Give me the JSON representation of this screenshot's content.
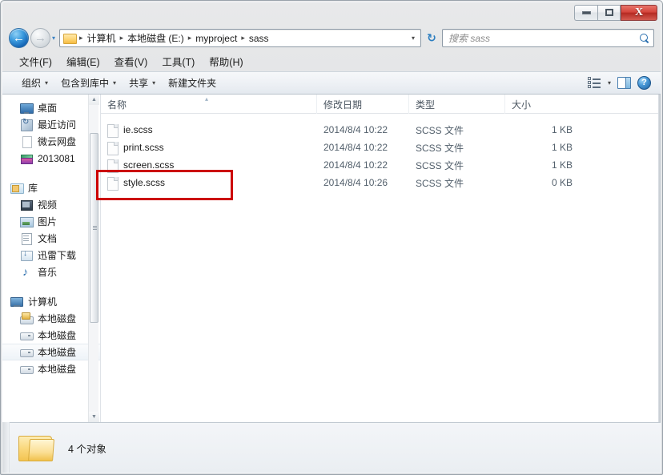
{
  "window": {
    "controls": {
      "minimize": "–",
      "maximize": "▭",
      "close": "X"
    }
  },
  "addressbar": {
    "back_glyph": "←",
    "forward_glyph": "→",
    "history_glyph": "▾",
    "dropdown_glyph": "▾",
    "refresh_glyph": "↻",
    "crumbs": [
      {
        "label": "计算机"
      },
      {
        "label": "本地磁盘 (E:)"
      },
      {
        "label": "myproject"
      },
      {
        "label": "sass"
      }
    ],
    "separator": "▸"
  },
  "search": {
    "placeholder": "搜索 sass"
  },
  "menubar": {
    "items": [
      {
        "label": "文件(F)"
      },
      {
        "label": "编辑(E)"
      },
      {
        "label": "查看(V)"
      },
      {
        "label": "工具(T)"
      },
      {
        "label": "帮助(H)"
      }
    ]
  },
  "commandbar": {
    "items": [
      {
        "label": "组织",
        "caret": "▾"
      },
      {
        "label": "包含到库中",
        "caret": "▾"
      },
      {
        "label": "共享",
        "caret": "▾"
      },
      {
        "label": "新建文件夹",
        "caret": ""
      }
    ],
    "views_caret": "▾",
    "help_glyph": "?"
  },
  "sidebar": {
    "favorites": [
      {
        "label": "桌面",
        "icon": "desktop-icon"
      },
      {
        "label": "最近访问",
        "icon": "recent-places-icon"
      },
      {
        "label": "微云网盘",
        "icon": "document-icon"
      },
      {
        "label": "2013081",
        "icon": "books-icon"
      }
    ],
    "library_head": {
      "label": "库",
      "icon": "library-icon"
    },
    "library_items": [
      {
        "label": "视频",
        "icon": "video-icon"
      },
      {
        "label": "图片",
        "icon": "pictures-icon"
      },
      {
        "label": "文档",
        "icon": "documents-icon"
      },
      {
        "label": "迅雷下载",
        "icon": "download-icon"
      },
      {
        "label": "音乐",
        "icon": "music-icon"
      }
    ],
    "computer_head": {
      "label": "计算机",
      "icon": "computer-icon"
    },
    "drives": [
      {
        "label": "本地磁盘",
        "icon": "system-disk-icon",
        "selected": false
      },
      {
        "label": "本地磁盘",
        "icon": "disk-icon",
        "selected": false
      },
      {
        "label": "本地磁盘",
        "icon": "disk-icon",
        "selected": true
      },
      {
        "label": "本地磁盘",
        "icon": "disk-icon",
        "selected": false
      }
    ],
    "scroll_up_glyph": "▲",
    "scroll_down_glyph": "▼"
  },
  "filelist": {
    "columns": [
      {
        "label": "名称"
      },
      {
        "label": "修改日期"
      },
      {
        "label": "类型"
      },
      {
        "label": "大小"
      }
    ],
    "sort_glyph": "▴",
    "rows": [
      {
        "name": "ie.scss",
        "date": "2014/8/4 10:22",
        "type": "SCSS 文件",
        "size": "1 KB"
      },
      {
        "name": "print.scss",
        "date": "2014/8/4 10:22",
        "type": "SCSS 文件",
        "size": "1 KB"
      },
      {
        "name": "screen.scss",
        "date": "2014/8/4 10:22",
        "type": "SCSS 文件",
        "size": "1 KB"
      },
      {
        "name": "style.scss",
        "date": "2014/8/4 10:26",
        "type": "SCSS 文件",
        "size": "0 KB"
      }
    ]
  },
  "annotation": {
    "color": "#cc0000"
  },
  "statusbar": {
    "text": "4 个对象"
  }
}
